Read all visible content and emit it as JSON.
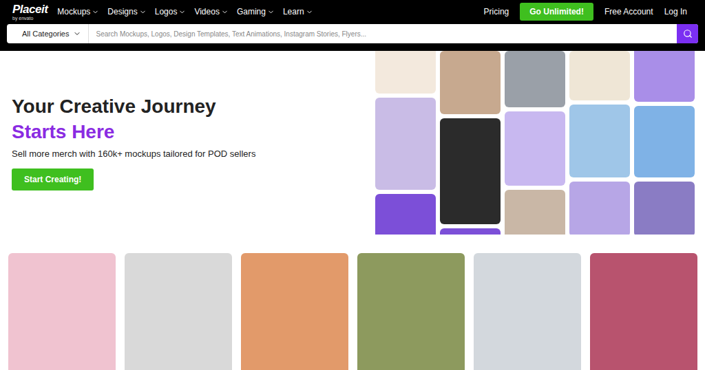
{
  "logo": {
    "name": "Placeit",
    "tagline": "by envato"
  },
  "nav": {
    "items": [
      {
        "label": "Mockups"
      },
      {
        "label": "Designs"
      },
      {
        "label": "Logos"
      },
      {
        "label": "Videos"
      },
      {
        "label": "Gaming"
      },
      {
        "label": "Learn"
      }
    ],
    "pricing": "Pricing",
    "cta": "Go Unlimited!",
    "free_account": "Free Account",
    "login": "Log In"
  },
  "search": {
    "category": "All Categories",
    "placeholder": "Search Mockups, Logos, Design Templates, Text Animations, Instagram Stories, Flyers..."
  },
  "hero": {
    "title": "Your Creative Journey",
    "highlight": "Starts Here",
    "subtitle": "Sell more merch with 160k+ mockups tailored for POD sellers",
    "button": "Start Creating!"
  }
}
